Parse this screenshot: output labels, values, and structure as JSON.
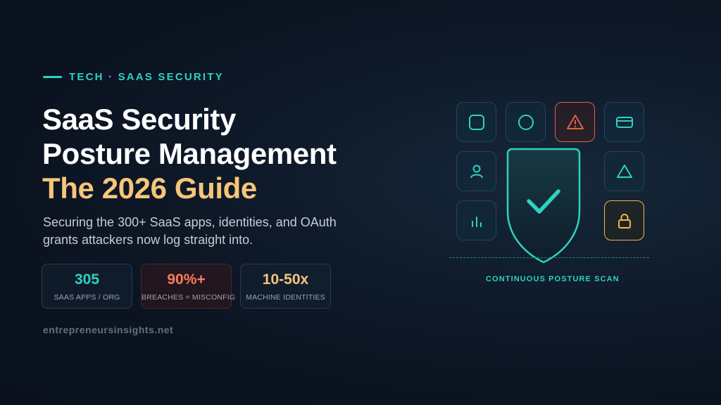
{
  "eyebrow": "TECH · SAAS SECURITY",
  "title": {
    "line1": "SaaS Security",
    "line2": "Posture Management",
    "line3": "The 2026 Guide"
  },
  "subtitle": "Securing the 300+ SaaS apps, identities, and OAuth grants attackers now log straight into.",
  "stats": [
    {
      "value": "305",
      "label": "SAAS APPS / ORG"
    },
    {
      "value": "90%+",
      "label": "BREACHES = MISCONFIG"
    },
    {
      "value": "10-50x",
      "label": "MACHINE IDENTITIES"
    }
  ],
  "site": "entrepreneursinsights.net",
  "graphic": {
    "scan_label": "CONTINUOUS POSTURE SCAN",
    "icons": [
      "square-icon",
      "circle-icon",
      "warning-icon",
      "card-icon",
      "user-icon",
      "triangle-icon",
      "bar-chart-icon",
      "lock-icon",
      "shield-check-icon"
    ]
  },
  "colors": {
    "accent_teal": "#2fd1c0",
    "accent_gold": "#f6c57a",
    "alert_red": "#e25e48",
    "lock_amber": "#f2b547",
    "background": "#0b1320"
  }
}
